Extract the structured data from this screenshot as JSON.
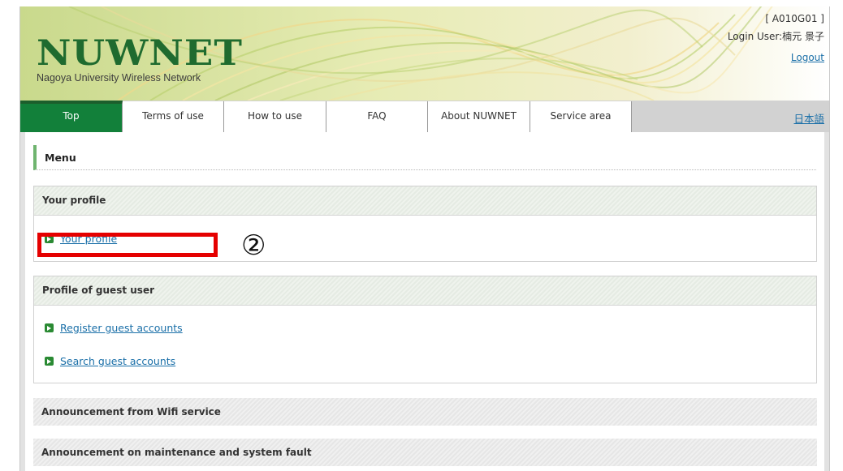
{
  "header": {
    "logo": "NUWNET",
    "logo_sub": "Nagoya University Wireless Network",
    "code": "[ A010G01 ]",
    "login": "Login User:楠元 景子",
    "logout": "Logout"
  },
  "nav": {
    "tabs": [
      {
        "label": "Top",
        "active": true
      },
      {
        "label": "Terms of use",
        "active": false
      },
      {
        "label": "How to use",
        "active": false
      },
      {
        "label": "FAQ",
        "active": false
      },
      {
        "label": "About NUWNET",
        "active": false
      },
      {
        "label": "Service area",
        "active": false
      }
    ],
    "lang": "日本語"
  },
  "menu": {
    "title": "Menu",
    "sections": [
      {
        "heading": "Your profile",
        "links": [
          "Your profile"
        ]
      },
      {
        "heading": "Profile of guest user",
        "links": [
          "Register guest accounts",
          "Search guest accounts"
        ]
      }
    ],
    "bars": [
      "Announcement from Wifi service",
      "Announcement on maintenance and system fault"
    ]
  },
  "annotation": {
    "marker": "②",
    "color": "#e50000"
  },
  "colors": {
    "brand_green": "#12803a",
    "logo_green": "#1f6b2f",
    "link": "#1a6fa8"
  }
}
